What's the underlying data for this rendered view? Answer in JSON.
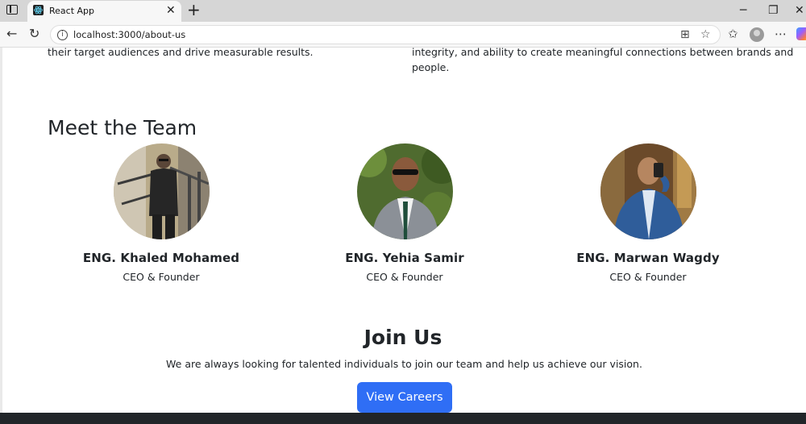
{
  "browser": {
    "tab_title": "React App",
    "tab_close": "✕",
    "new_tab": "+",
    "url": "localhost:3000/about-us",
    "window_controls": {
      "minimize": "─",
      "restore": "❐",
      "close": "✕"
    },
    "nav": {
      "back": "←",
      "reload": "↻"
    },
    "icons": [
      "info-icon",
      "split-screen-icon",
      "star-icon",
      "favorites-icon",
      "profile-icon",
      "more-icon",
      "copilot-icon"
    ]
  },
  "page": {
    "left_paragraph_tail": "their target audiences and drive measurable results.",
    "right_paragraph_tail_line1": "integrity, and ability to create meaningful connections between brands and",
    "right_paragraph_tail_line2": "people.",
    "team": {
      "heading": "Meet the Team",
      "members": [
        {
          "name": "ENG. Khaled Mohamed",
          "role": "CEO & Founder"
        },
        {
          "name": "ENG. Yehia Samir",
          "role": "CEO & Founder"
        },
        {
          "name": "ENG. Marwan Wagdy",
          "role": "CEO & Founder"
        }
      ]
    },
    "join": {
      "heading": "Join Us",
      "text": "We are always looking for talented individuals to join our team and help us achieve our vision.",
      "button_label": "View Careers"
    }
  },
  "colors": {
    "button": "#2f6ef5",
    "footer": "#212529",
    "text": "#212529"
  }
}
